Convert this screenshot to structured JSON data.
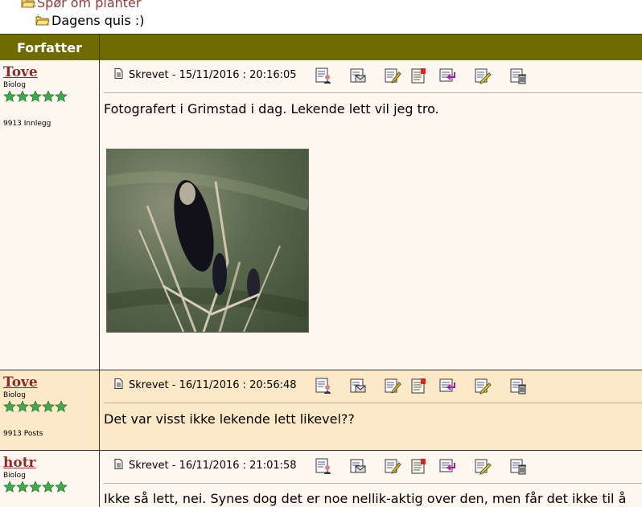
{
  "breadcrumbs": [
    {
      "label": "Spør om planter"
    },
    {
      "label": "Dagens quis :)"
    }
  ],
  "table": {
    "author_header": "Forfatter"
  },
  "posts": [
    {
      "author": "Tove",
      "role": "Biolog",
      "stars": 5,
      "count": "9913 Innlegg",
      "written": "Skrevet - 15/11/2016 :  20:16:05",
      "text": "Fotografert i Grimstad i dag. Lekende lett vil jeg tro.",
      "has_image": true
    },
    {
      "author": "Tove",
      "role": "Biolog",
      "stars": 5,
      "count": "9913 Posts",
      "written": "Skrevet - 16/11/2016 :  20:56:48",
      "text": "Det var visst ikke lekende lett likevel??",
      "has_image": false
    },
    {
      "author": "hotr",
      "role": "Biolog",
      "stars": 5,
      "count": "",
      "written": "Skrevet - 16/11/2016 :  21:01:58",
      "text": "Ikke så lett, nei. Synes dog det er noe nellik-aktig over den, men får det ikke til å",
      "has_image": false
    }
  ],
  "toolbar_icons": [
    "profile-icon",
    "email-icon",
    "edit-icon",
    "reply-quote-icon",
    "reply-icon",
    "edit-note-icon",
    "delete-icon"
  ]
}
